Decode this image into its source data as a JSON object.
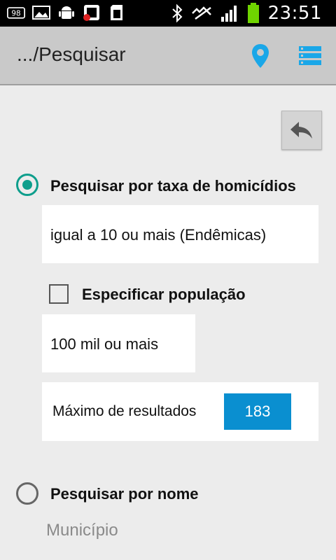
{
  "status_bar": {
    "time": "23:51",
    "icons": [
      "notification-98-icon",
      "image-icon",
      "android-icon",
      "app-icon",
      "sd-card-icon",
      "bluetooth-icon",
      "mute-icon",
      "signal-icon",
      "battery-icon"
    ],
    "badge_text": "98",
    "battery_color": "#6fd400"
  },
  "action_bar": {
    "title": ".../Pesquisar",
    "pin_color": "#1aa7e8",
    "menu_color": "#1aa7e8"
  },
  "search_rate": {
    "label": "Pesquisar por taxa de homicídios",
    "selected": true,
    "rate_value": "igual a 10 ou mais (Endêmicas)"
  },
  "population": {
    "checkbox_label": "Especificar população",
    "checked": false,
    "value": "100 mil ou mais"
  },
  "max_results": {
    "label": "Máximo de resultados",
    "value": "183"
  },
  "search_name": {
    "label": "Pesquisar por nome",
    "selected": false,
    "placeholder": "Município"
  },
  "accent_color": "#0e9e8c"
}
